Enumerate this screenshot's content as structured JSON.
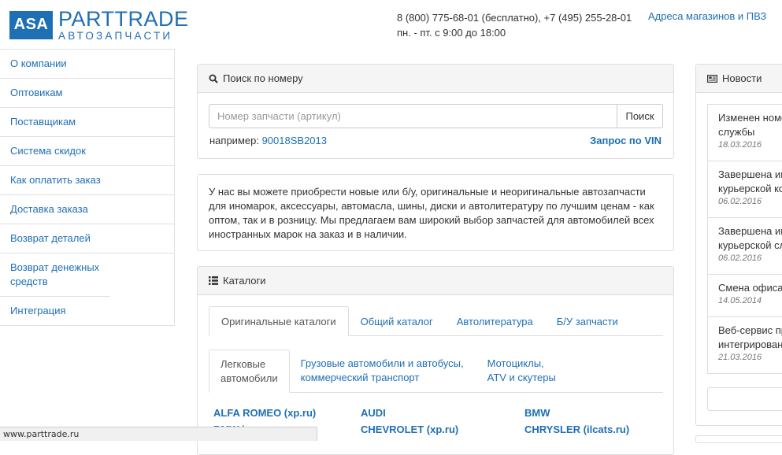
{
  "header": {
    "logo_box": "ASA",
    "logo_main": "PARTTRADE",
    "logo_sub": "АВТОЗАПЧАСТИ",
    "phones": "8 (800) 775-68-01 (бесплатно), +7 (495) 255-28-01",
    "hours": "пн. - пт. с 9:00 до 18:00",
    "shops_link": "Адреса магазинов и ПВЗ"
  },
  "sidebar": {
    "items": [
      {
        "label": "О компании"
      },
      {
        "label": "Оптовикам"
      },
      {
        "label": "Поставщикам"
      },
      {
        "label": "Система скидок"
      },
      {
        "label": "Как оплатить заказ"
      },
      {
        "label": "Доставка заказа"
      },
      {
        "label": "Возврат деталей"
      },
      {
        "label": "Возврат денежных средств"
      },
      {
        "label": "Интеграция"
      }
    ]
  },
  "search": {
    "title": "Поиск по номеру",
    "placeholder": "Номер запчасти (артикул)",
    "button": "Поиск",
    "example_label": "например:",
    "example_value": "90018SB2013",
    "vin_link": "Запрос по VIN"
  },
  "intro": {
    "text": "У нас вы можете приобрести новые или б/у, оригинальные и неоригинальные автозапчасти для иномарок, аксессуары, автомасла, шины, диски и автолитературу по лучшим ценам - как оптом, так и в розницу. Мы предлагаем вам широкий выбор запчастей для автомобилей всех иностранных марок на заказ и в наличии."
  },
  "catalogs": {
    "title": "Каталоги",
    "tabs": [
      {
        "label": "Оригинальные каталоги"
      },
      {
        "label": "Общий каталог"
      },
      {
        "label": "Автолитература"
      },
      {
        "label": "Б/У запчасти"
      }
    ],
    "subtabs": [
      {
        "line1": "Легковые",
        "line2": "автомобили"
      },
      {
        "line1": "Грузовые автомобили и автобусы,",
        "line2": "коммерческий транспорт"
      },
      {
        "line1": "Мотоциклы,",
        "line2": "ATV и скутеры"
      }
    ],
    "brands": [
      "ALFA ROMEO (xp.ru)",
      "AUDI",
      "BMW",
      "BMW i",
      "CHEVROLET (xp.ru)",
      "CHRYSLER (ilcats.ru)"
    ]
  },
  "news": {
    "title": "Новости",
    "items": [
      {
        "title1": "Изменен номе",
        "title2": "службы",
        "date": "18.03.2016"
      },
      {
        "title1": "Завершена ин",
        "title2": "курьерской ко",
        "date": "06.02.2016"
      },
      {
        "title1": "Завершена ин",
        "title2": "курьерской сл",
        "date": "06.02.2016"
      },
      {
        "title1": "Смена офиса",
        "title2": "",
        "date": "14.05.2014"
      },
      {
        "title1": "Веб-сервис пр",
        "title2": "интегрирован",
        "date": "21.03.2016"
      }
    ]
  },
  "status_bar": {
    "url": "www.parttrade.ru"
  },
  "colors": {
    "brand_blue": "#1f6fb5",
    "panel_heading_bg": "#f5f5f5",
    "border": "#dddddd"
  }
}
